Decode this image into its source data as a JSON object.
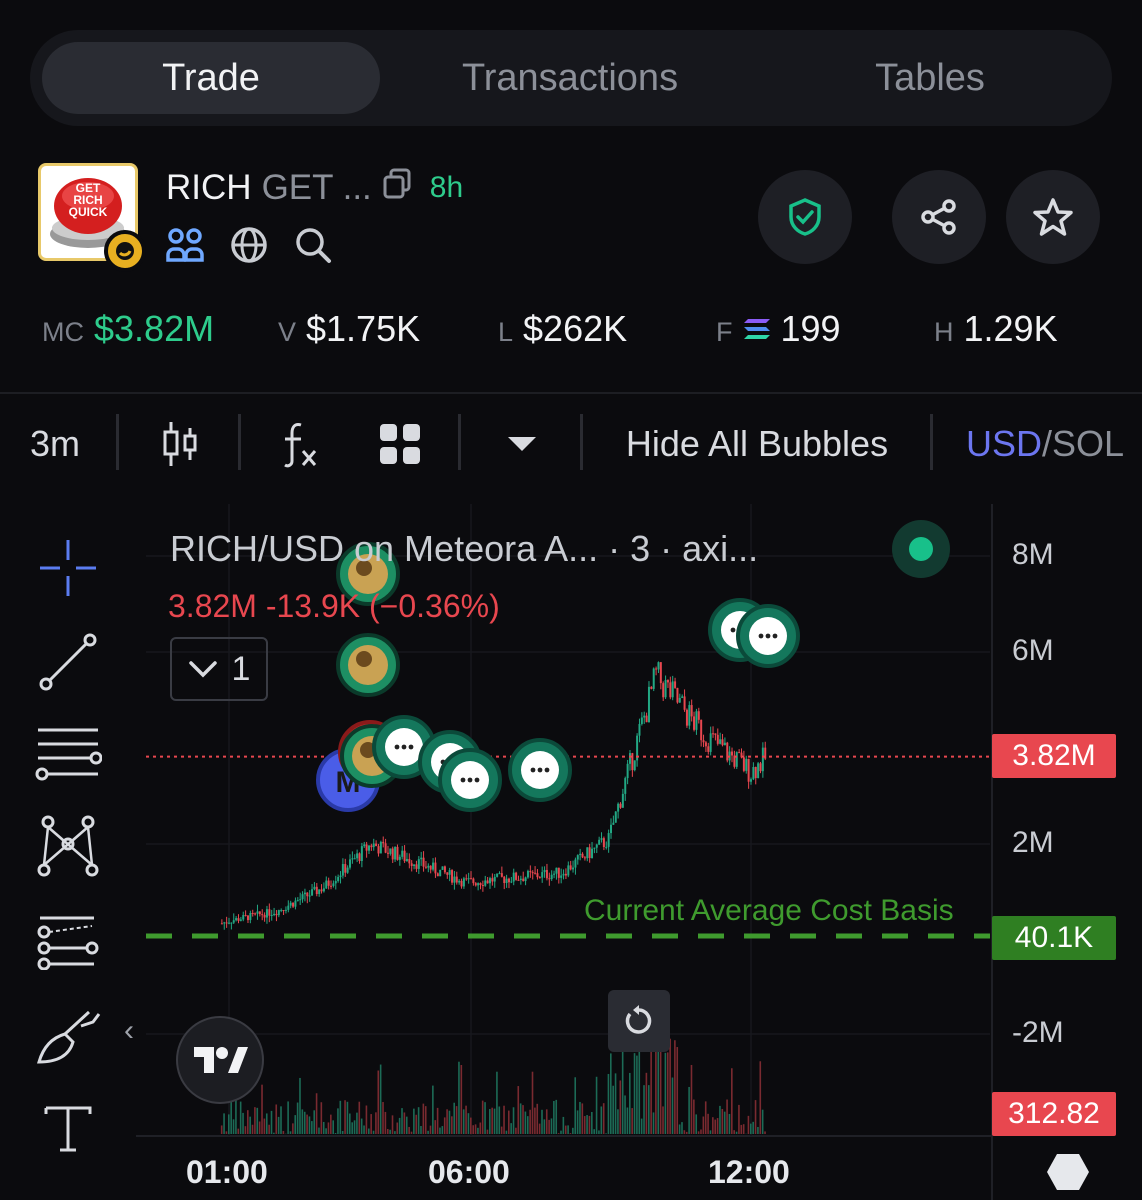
{
  "tabs": [
    {
      "label": "Trade",
      "active": true
    },
    {
      "label": "Transactions",
      "active": false
    },
    {
      "label": "Tables",
      "active": false
    }
  ],
  "token": {
    "symbol": "RICH",
    "name": "GET ...",
    "age": "8h",
    "logo_text": [
      "GET",
      "RICH",
      "QUICK"
    ]
  },
  "stats": {
    "mc": {
      "key": "MC",
      "value": "$3.82M"
    },
    "v": {
      "key": "V",
      "value": "$1.75K"
    },
    "l": {
      "key": "L",
      "value": "$262K"
    },
    "f": {
      "key": "F",
      "value": "199"
    },
    "h": {
      "key": "H",
      "value": "1.29K"
    }
  },
  "toolbar": {
    "interval": "3m",
    "hide_bubbles": "Hide All Bubbles",
    "currency_usd": "USD",
    "currency_sep": "/",
    "currency_sol": "SOL"
  },
  "chart": {
    "legend_title": "RICH/USD on Meteora A... · 3 · axi...",
    "legend_price": "3.82M  -13.9K (−0.36%)",
    "collapse_count": "1",
    "cost_basis_label": "Current Average Cost Basis",
    "price_tag": "3.82M",
    "cost_tag": "40.1K",
    "volume_tag": "312.82",
    "marker_letter": "M",
    "colors": {
      "up": "#22a884",
      "down": "#e8474f",
      "cost_line": "#3f9b2e",
      "usd_accent": "#6c76f0"
    }
  },
  "chart_data": {
    "type": "line",
    "title": "RICH/USD on Meteora A... · 3 · axi...",
    "xlabel": "",
    "ylabel": "",
    "x_ticks": [
      "01:00",
      "06:00",
      "12:00"
    ],
    "y_ticks": [
      "8M",
      "6M",
      "2M",
      "-2M"
    ],
    "series": [
      {
        "x": [
          "00:00",
          "01:00",
          "02:00",
          "03:00",
          "04:00",
          "05:00",
          "06:00",
          "07:00",
          "08:00",
          "09:00",
          "10:00",
          "11:00",
          "12:00",
          "12:20"
        ],
        "values": [
          0.05,
          0.4,
          0.6,
          1.1,
          2.0,
          1.6,
          1.2,
          1.3,
          1.4,
          2.1,
          5.5,
          4.3,
          3.5,
          3.82
        ]
      }
    ],
    "current_price": 3.82,
    "cost_basis": 0.0401,
    "unit": "M"
  }
}
